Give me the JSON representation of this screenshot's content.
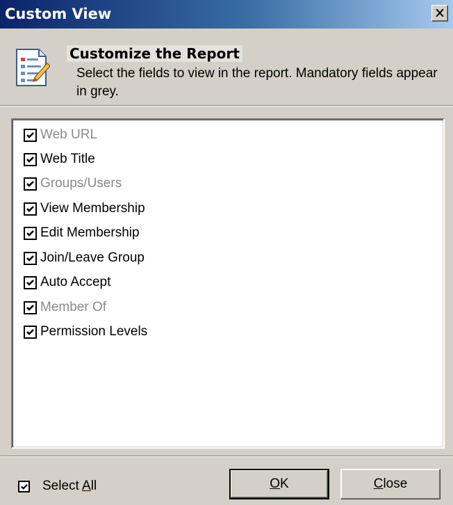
{
  "window": {
    "title": "Custom View",
    "close_icon": "close-icon"
  },
  "header": {
    "icon": "report-customize-icon",
    "title": "Customize the Report",
    "description": "Select the fields to view in the report. Mandatory fields appear in grey."
  },
  "fields": [
    {
      "label": "Web URL",
      "checked": true,
      "mandatory": true
    },
    {
      "label": "Web Title",
      "checked": true,
      "mandatory": false
    },
    {
      "label": "Groups/Users",
      "checked": true,
      "mandatory": true
    },
    {
      "label": "View Membership",
      "checked": true,
      "mandatory": false
    },
    {
      "label": "Edit Membership",
      "checked": true,
      "mandatory": false
    },
    {
      "label": "Join/Leave Group",
      "checked": true,
      "mandatory": false
    },
    {
      "label": "Auto Accept",
      "checked": true,
      "mandatory": false
    },
    {
      "label": "Member Of",
      "checked": true,
      "mandatory": true
    },
    {
      "label": "Permission Levels",
      "checked": true,
      "mandatory": false
    }
  ],
  "footer": {
    "select_all_pre": "Select ",
    "select_all_accel": "A",
    "select_all_post": "ll",
    "select_all_checked": true,
    "ok_accel": "O",
    "ok_rest": "K",
    "close_accel": "C",
    "close_rest": "lose"
  }
}
